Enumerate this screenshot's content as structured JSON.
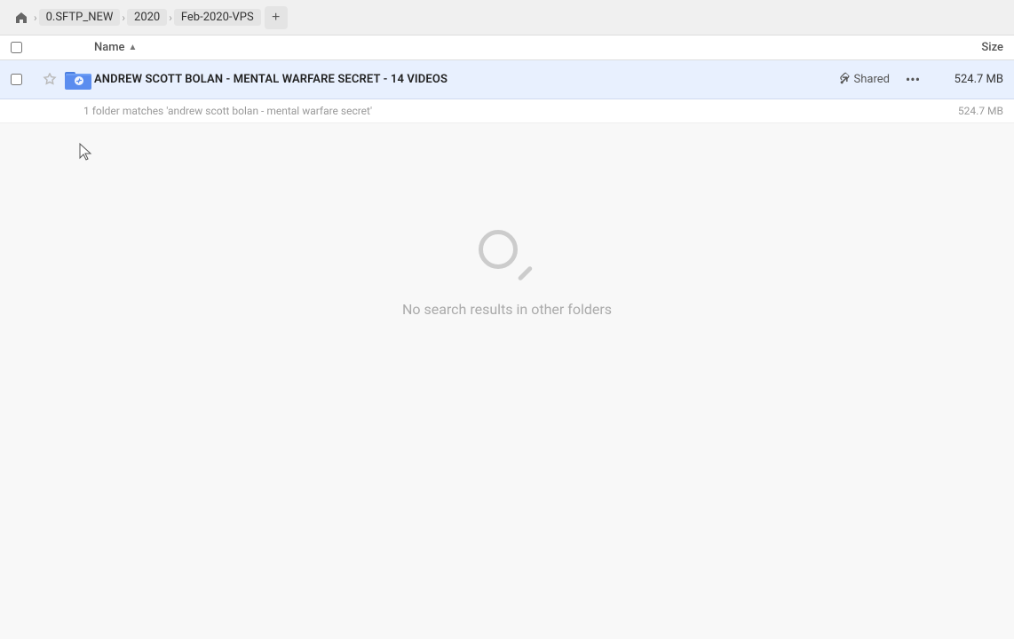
{
  "breadcrumb": {
    "home_label": "Home",
    "items": [
      {
        "label": "0.SFTP_NEW"
      },
      {
        "label": "2020"
      },
      {
        "label": "Feb-2020-VPS"
      }
    ],
    "add_tab_icon": "+"
  },
  "table": {
    "name_col_label": "Name",
    "size_col_label": "Size",
    "sort_arrow": "▲"
  },
  "file_row": {
    "name": "ANDREW SCOTT BOLAN - MENTAL WARFARE SECRET - 14 VIDEOS",
    "shared_label": "Shared",
    "size": "524.7 MB",
    "more_icon": "•••"
  },
  "match_info": {
    "text": "1 folder matches 'andrew scott bolan - mental warfare secret'",
    "size": "524.7 MB"
  },
  "empty_state": {
    "text": "No search results in other folders"
  }
}
